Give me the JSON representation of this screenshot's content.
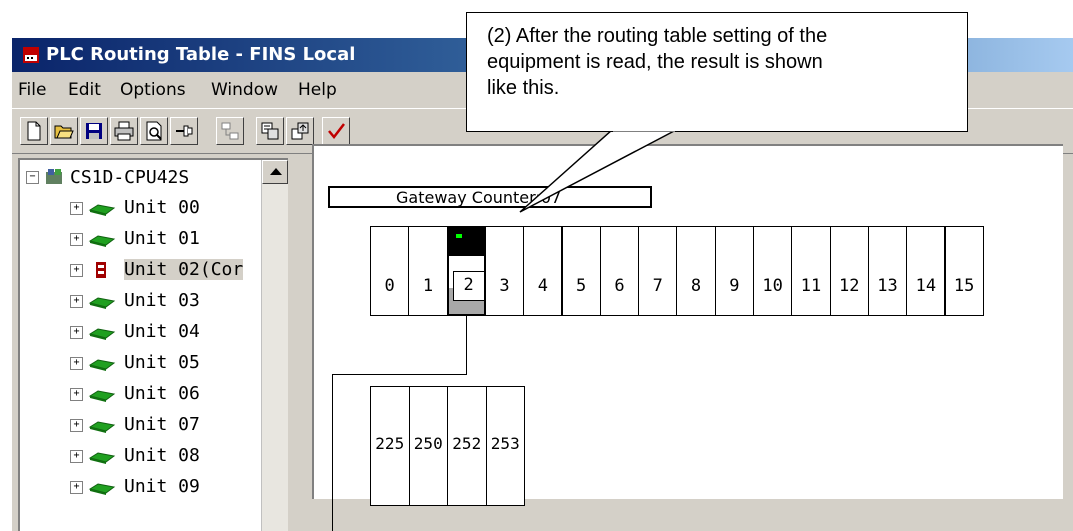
{
  "window": {
    "title": "PLC Routing Table - FINS Local"
  },
  "menu": [
    "File",
    "Edit",
    "Options",
    "Window",
    "Help"
  ],
  "toolbar": [
    "new-icon",
    "open-icon",
    "save-icon",
    "print-icon",
    "print-preview-icon",
    "pin-icon",
    "network-transfer-icon",
    "read-from-plc-icon",
    "write-to-plc-icon",
    "check-icon"
  ],
  "tree": {
    "root": "CS1D-CPU42S",
    "units": [
      "Unit 00",
      "Unit 01",
      "Unit 02(Cor",
      "Unit 03",
      "Unit 04",
      "Unit 05",
      "Unit 06",
      "Unit 07",
      "Unit 08",
      "Unit 09"
    ]
  },
  "diagram": {
    "gateway": "Gateway Counter:07",
    "slots": [
      "0",
      "1",
      "2",
      "3",
      "4",
      "5",
      "6",
      "7",
      "8",
      "9",
      "10",
      "11",
      "12",
      "13",
      "14",
      "15"
    ],
    "active_slot": "2",
    "networks": [
      "225",
      "250",
      "252",
      "253"
    ]
  },
  "callout": {
    "lines": [
      "(2) After the routing table setting of the",
      "equipment is read, the result is shown",
      "like this."
    ]
  },
  "colors": {
    "title_start": "#0a246a",
    "title_end": "#a6caf0",
    "face": "#d4d0c8",
    "led": "#00ff00"
  }
}
